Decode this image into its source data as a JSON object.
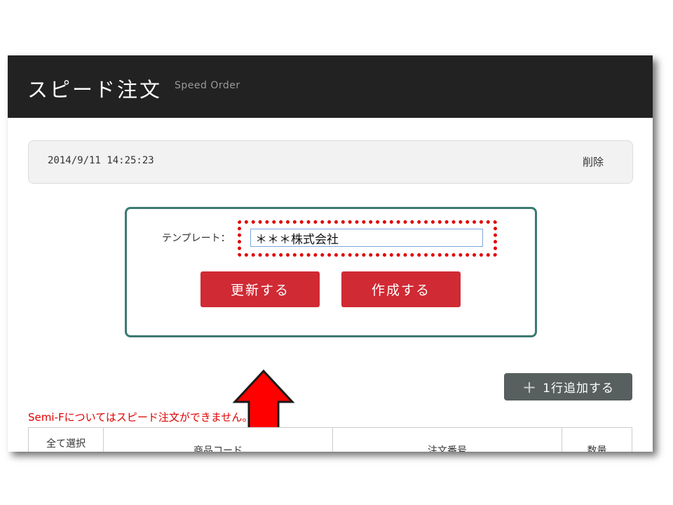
{
  "header": {
    "title": "スピード注文",
    "subtitle": "Speed Order"
  },
  "record": {
    "timestamp": "2014/9/11 14:25:23",
    "delete_label": "削除"
  },
  "template_panel": {
    "label": "テンプレート：",
    "input_value": "＊＊＊株式会社",
    "update_button": "更新する",
    "create_button": "作成する"
  },
  "add_row": {
    "icon": "plus-icon",
    "label": "1行追加する"
  },
  "warning": "Semi-Fについてはスピード注文ができません。",
  "table": {
    "columns": [
      "全て選択",
      "商品コード",
      "注文番号",
      "数量"
    ]
  },
  "colors": {
    "header_bg": "#222222",
    "button_red": "#d02a34",
    "panel_border": "#3d7a72",
    "highlight": "#e00000",
    "add_button": "#57605f",
    "warning_text": "#e00000"
  }
}
